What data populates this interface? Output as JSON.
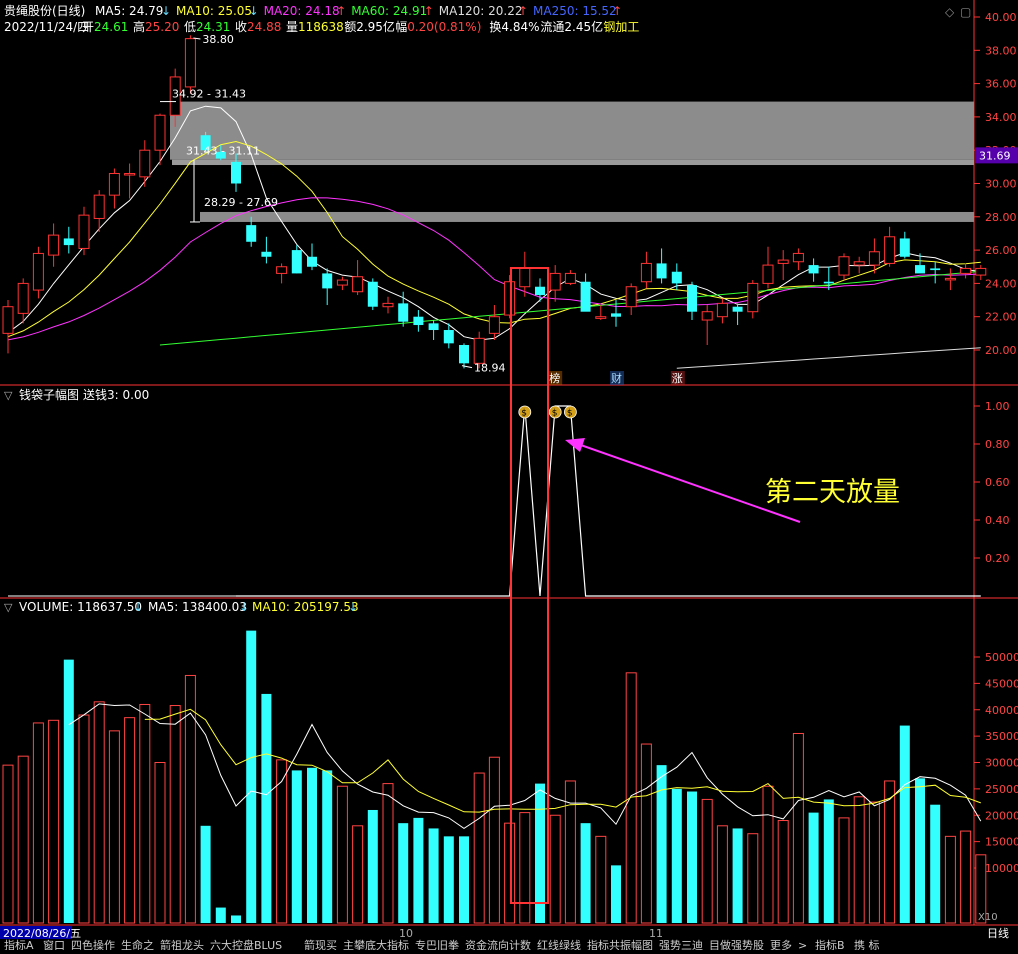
{
  "header": {
    "stock_name": "贵绳股份(日线)",
    "date_line": "2022/11/24/四",
    "ma": [
      {
        "label": "MA5: 24.79",
        "arrow": "↓",
        "color": "#ffffff"
      },
      {
        "label": "MA10: 25.05",
        "arrow": "↓",
        "color": "#ffff33"
      },
      {
        "label": "MA20: 24.18",
        "arrow": "↑",
        "color": "#ff33ff"
      },
      {
        "label": "MA60: 24.91",
        "arrow": "↑",
        "color": "#33ff33"
      },
      {
        "label": "MA120: 20.22",
        "arrow": "↑",
        "color": "#dddddd"
      },
      {
        "label": "MA250: 15.52",
        "arrow": "↑",
        "color": "#4466ff"
      }
    ],
    "quote": [
      {
        "label": "开",
        "value": "24.61",
        "color": "#33ff33"
      },
      {
        "label": "高",
        "value": "25.20",
        "color": "#ff4444"
      },
      {
        "label": "低",
        "value": "24.31",
        "color": "#33ff33"
      },
      {
        "label": "收",
        "value": "24.88",
        "color": "#ff4444"
      },
      {
        "label": "量",
        "value": "118638",
        "color": "#ffff33"
      },
      {
        "label": "额",
        "value": "2.95亿",
        "color": "#ffffff"
      },
      {
        "label": "幅",
        "value": "0.20(0.81%)",
        "color": "#ff4444"
      },
      {
        "label": "换",
        "value": "4.84%",
        "color": "#ffffff"
      },
      {
        "label": "流通",
        "value": "2.45亿",
        "color": "#ffffff"
      },
      {
        "label": "",
        "value": "钢加工",
        "color": "#ffff33"
      }
    ]
  },
  "price_axis": {
    "ticks": [
      "40.00",
      "38.00",
      "36.00",
      "34.00",
      "32.00",
      "30.00",
      "28.00",
      "26.00",
      "24.00",
      "22.00",
      "20.00"
    ],
    "current": "31.69"
  },
  "price_annotations": {
    "high": "38.80",
    "low": "18.94",
    "zone1": "34.92 - 31.43",
    "zone2": "31.43 - 31.11",
    "zone3": "28.29 - 27.69",
    "markers": [
      "榜",
      "财",
      "涨"
    ]
  },
  "indicator": {
    "title": "钱袋子幅图",
    "value_label": "送钱3: 0.00",
    "ticks": [
      "1.00",
      "0.80",
      "0.60",
      "0.40",
      "0.20"
    ],
    "annotation": "第二天放量"
  },
  "volume": {
    "title": "VOLUME: 118637.50",
    "title_arrow": "↓",
    "ma5": "MA5: 138400.03",
    "ma5_arrow": "↓",
    "ma10": "MA10: 205197.53",
    "ma10_arrow": "↓",
    "ticks": [
      "50000",
      "45000",
      "40000",
      "35000",
      "30000",
      "25000",
      "20000",
      "15000",
      "10000"
    ],
    "unit": "X10"
  },
  "xaxis": {
    "start_date": "2022/08/26/五",
    "month_labels": [
      "10",
      "11"
    ],
    "right_label": "日线"
  },
  "bottom_tabs": [
    "指标A",
    "窗口",
    "四色操作",
    "生命之",
    "箭祖龙头",
    "六大控盘BLUS",
    "箭现买",
    "主攀底大指标",
    "专巴旧拳",
    "资金流向计数",
    "红线绿线",
    "指标共振幅图",
    "强势三迪",
    "目做强势股",
    "更多",
    ">",
    "指标B",
    "携 标"
  ],
  "chart_data": [
    {
      "type": "candlestick",
      "title": "贵绳股份(日线)",
      "ylim": [
        18.5,
        41
      ],
      "x": [
        "2022/08/26",
        "",
        "",
        "",
        "",
        "",
        "",
        "",
        "",
        "",
        "",
        "",
        "",
        "",
        "",
        "",
        "",
        "",
        "",
        "",
        "",
        "",
        "",
        "",
        "",
        "",
        "",
        "",
        "",
        "",
        "",
        "",
        "",
        "",
        "",
        "",
        "",
        "",
        "",
        "",
        "",
        "",
        "",
        "",
        "",
        "",
        "",
        "",
        "",
        "",
        "",
        "",
        "",
        "",
        "",
        "",
        "",
        "",
        "",
        "",
        "",
        "2022/11/24"
      ],
      "ohlc": [
        [
          21.0,
          23.0,
          19.8,
          22.6
        ],
        [
          22.2,
          24.3,
          21.6,
          24.0
        ],
        [
          23.6,
          26.2,
          23.1,
          25.8
        ],
        [
          25.7,
          27.6,
          25.0,
          26.9
        ],
        [
          26.7,
          27.4,
          25.8,
          26.3
        ],
        [
          26.1,
          28.6,
          25.7,
          28.1
        ],
        [
          27.9,
          29.6,
          27.1,
          29.3
        ],
        [
          29.3,
          30.9,
          28.5,
          30.6
        ],
        [
          30.6,
          31.2,
          29.1,
          30.6
        ],
        [
          30.4,
          32.6,
          29.8,
          32.0
        ],
        [
          32.0,
          34.2,
          31.1,
          34.1
        ],
        [
          34.1,
          36.9,
          33.4,
          36.4
        ],
        [
          35.8,
          38.9,
          35.4,
          38.7
        ],
        [
          32.9,
          33.1,
          31.8,
          32.0
        ],
        [
          31.9,
          32.3,
          31.4,
          31.5
        ],
        [
          31.3,
          31.8,
          29.5,
          30.0
        ],
        [
          27.5,
          28.0,
          26.2,
          26.5
        ],
        [
          25.9,
          26.8,
          25.2,
          25.6
        ],
        [
          24.6,
          25.2,
          24.0,
          25.0
        ],
        [
          26.0,
          26.3,
          24.6,
          24.6
        ],
        [
          25.6,
          26.4,
          24.8,
          25.0
        ],
        [
          24.6,
          24.9,
          22.7,
          23.7
        ],
        [
          23.9,
          24.4,
          23.6,
          24.2
        ],
        [
          23.5,
          25.4,
          23.3,
          24.4
        ],
        [
          24.1,
          24.3,
          22.4,
          22.6
        ],
        [
          22.6,
          23.2,
          22.2,
          22.8
        ],
        [
          22.8,
          23.5,
          21.4,
          21.7
        ],
        [
          22.0,
          22.4,
          21.1,
          21.5
        ],
        [
          21.6,
          21.8,
          20.6,
          21.2
        ],
        [
          21.2,
          21.6,
          20.1,
          20.4
        ],
        [
          20.3,
          20.4,
          18.9,
          19.2
        ],
        [
          19.2,
          21.1,
          18.9,
          20.7
        ],
        [
          21.0,
          22.7,
          20.6,
          22.0
        ],
        [
          22.1,
          24.5,
          21.9,
          24.1
        ],
        [
          23.8,
          25.9,
          23.2,
          24.9
        ],
        [
          23.8,
          24.3,
          22.9,
          23.3
        ],
        [
          23.6,
          25.1,
          22.9,
          24.6
        ],
        [
          24.0,
          24.8,
          23.9,
          24.6
        ],
        [
          24.1,
          24.6,
          22.4,
          22.3
        ],
        [
          21.9,
          22.7,
          21.8,
          22.0
        ],
        [
          22.2,
          23.0,
          21.4,
          22.0
        ],
        [
          22.6,
          24.0,
          22.1,
          23.8
        ],
        [
          24.1,
          25.9,
          23.7,
          25.2
        ],
        [
          25.2,
          26.1,
          24.0,
          24.3
        ],
        [
          24.7,
          25.2,
          23.6,
          24.0
        ],
        [
          23.9,
          24.1,
          21.8,
          22.3
        ],
        [
          21.8,
          22.7,
          20.3,
          22.3
        ],
        [
          22.0,
          23.1,
          21.6,
          22.8
        ],
        [
          22.6,
          22.8,
          21.5,
          22.3
        ],
        [
          22.3,
          24.2,
          21.9,
          24.0
        ],
        [
          24.0,
          26.2,
          23.7,
          25.1
        ],
        [
          25.2,
          26.0,
          24.2,
          25.4
        ],
        [
          25.3,
          26.1,
          24.8,
          25.8
        ],
        [
          25.1,
          25.5,
          24.1,
          24.6
        ],
        [
          24.1,
          25.0,
          23.6,
          24.0
        ],
        [
          24.5,
          25.8,
          24.2,
          25.6
        ],
        [
          25.1,
          25.6,
          24.6,
          25.3
        ],
        [
          25.1,
          26.7,
          24.6,
          25.9
        ],
        [
          25.2,
          27.4,
          25.0,
          26.8
        ],
        [
          26.7,
          27.1,
          25.5,
          25.6
        ],
        [
          25.1,
          25.8,
          24.8,
          24.6
        ],
        [
          24.9,
          25.3,
          24.0,
          24.8
        ],
        [
          24.3,
          24.9,
          23.6,
          24.3
        ],
        [
          24.6,
          25.2,
          24.3,
          24.9
        ],
        [
          24.5,
          25.1,
          24.2,
          24.9
        ]
      ]
    },
    {
      "type": "line",
      "title": "钱袋子幅图",
      "ylim": [
        0,
        1.1
      ],
      "signal_days": [
        34,
        36,
        37
      ],
      "values_note": "0 except spikes to 1.00 on signal days"
    },
    {
      "type": "bar",
      "title": "VOLUME",
      "ylim": [
        0,
        55000
      ],
      "values": [
        29500,
        31200,
        37500,
        38000,
        49500,
        39000,
        41500,
        36000,
        38500,
        41000,
        30000,
        40800,
        46500,
        18000,
        2500,
        1000,
        55000,
        43000,
        30500,
        28500,
        29000,
        28500,
        25500,
        18000,
        21000,
        26000,
        18500,
        19500,
        17500,
        16000,
        16000,
        28000,
        31000,
        18500,
        20500,
        26000,
        20000,
        26500,
        18500,
        16000,
        10500,
        47000,
        33500,
        29500,
        25000,
        24500,
        23000,
        18000,
        17500,
        16500,
        25500,
        19000,
        35500,
        20500,
        23000,
        19500,
        23500,
        22500,
        26500,
        37000,
        27000,
        22000,
        16000,
        17000,
        12500,
        12500,
        12000
      ]
    }
  ]
}
